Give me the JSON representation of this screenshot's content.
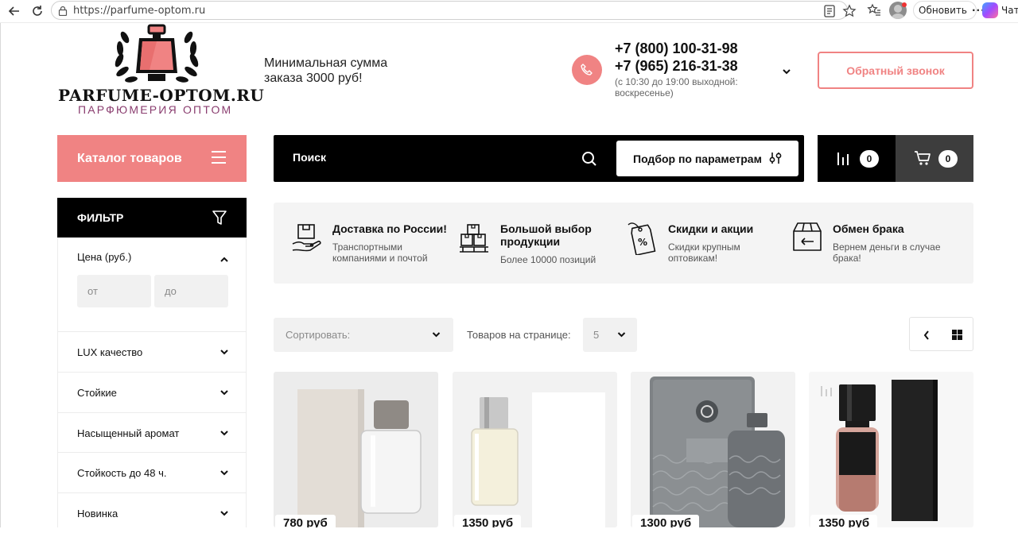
{
  "browser": {
    "url": "https://parfume-optom.ru",
    "update_label": "Обновить",
    "more_label": "···",
    "chat_label": "Чат"
  },
  "header": {
    "logo_title": "PARFUME-OPTOM.RU",
    "logo_subtitle": "ПАРФЮМЕРИЯ ОПТОМ",
    "min_order": "Минимальная сумма заказа 3000 руб!",
    "phone_1": "+7 (800) 100-31-98",
    "phone_2": "+7 (965) 216-31-38",
    "hours": "(с 10:30 до 19:00 выходной: воскресенье)",
    "callback_label": "Обратный звонок"
  },
  "nav": {
    "catalog_label": "Каталог товаров",
    "search_placeholder": "Поиск",
    "params_label": "Подбор по параметрам",
    "compare_count": "0",
    "cart_count": "0"
  },
  "filter": {
    "title": "ФИЛЬТР",
    "price_title": "Цена (руб.)",
    "price_from_placeholder": "от",
    "price_to_placeholder": "до",
    "groups": [
      {
        "label": "LUX качество"
      },
      {
        "label": "Стойкие"
      },
      {
        "label": "Насыщенный аромат"
      },
      {
        "label": "Стойкость до 48 ч."
      },
      {
        "label": "Новинка"
      }
    ]
  },
  "features": [
    {
      "title": "Доставка по России!",
      "text": "Транспортными компаниями и почтой",
      "icon": "delivery-icon"
    },
    {
      "title": "Большой выбор продукции",
      "text": "Более 10000 позиций",
      "icon": "boxes-icon"
    },
    {
      "title": "Скидки и акции",
      "text": "Скидки крупным оптовикам!",
      "icon": "discount-tag-icon"
    },
    {
      "title": "Обмен брака",
      "text": "Вернем деньги в случае брака!",
      "icon": "return-box-icon"
    }
  ],
  "toolbar": {
    "sort_placeholder": "Сортировать:",
    "per_page_label": "Товаров на странице:",
    "per_page_value": "5"
  },
  "products": [
    {
      "price": "780 руб"
    },
    {
      "price": "1350 руб"
    },
    {
      "price": "1300 руб"
    },
    {
      "price": "1350 руб"
    }
  ],
  "colors": {
    "accent": "#f08383",
    "dark": "#000000",
    "cart_bg": "#3d3d3d",
    "logo_subtitle": "#8a3d6f"
  }
}
